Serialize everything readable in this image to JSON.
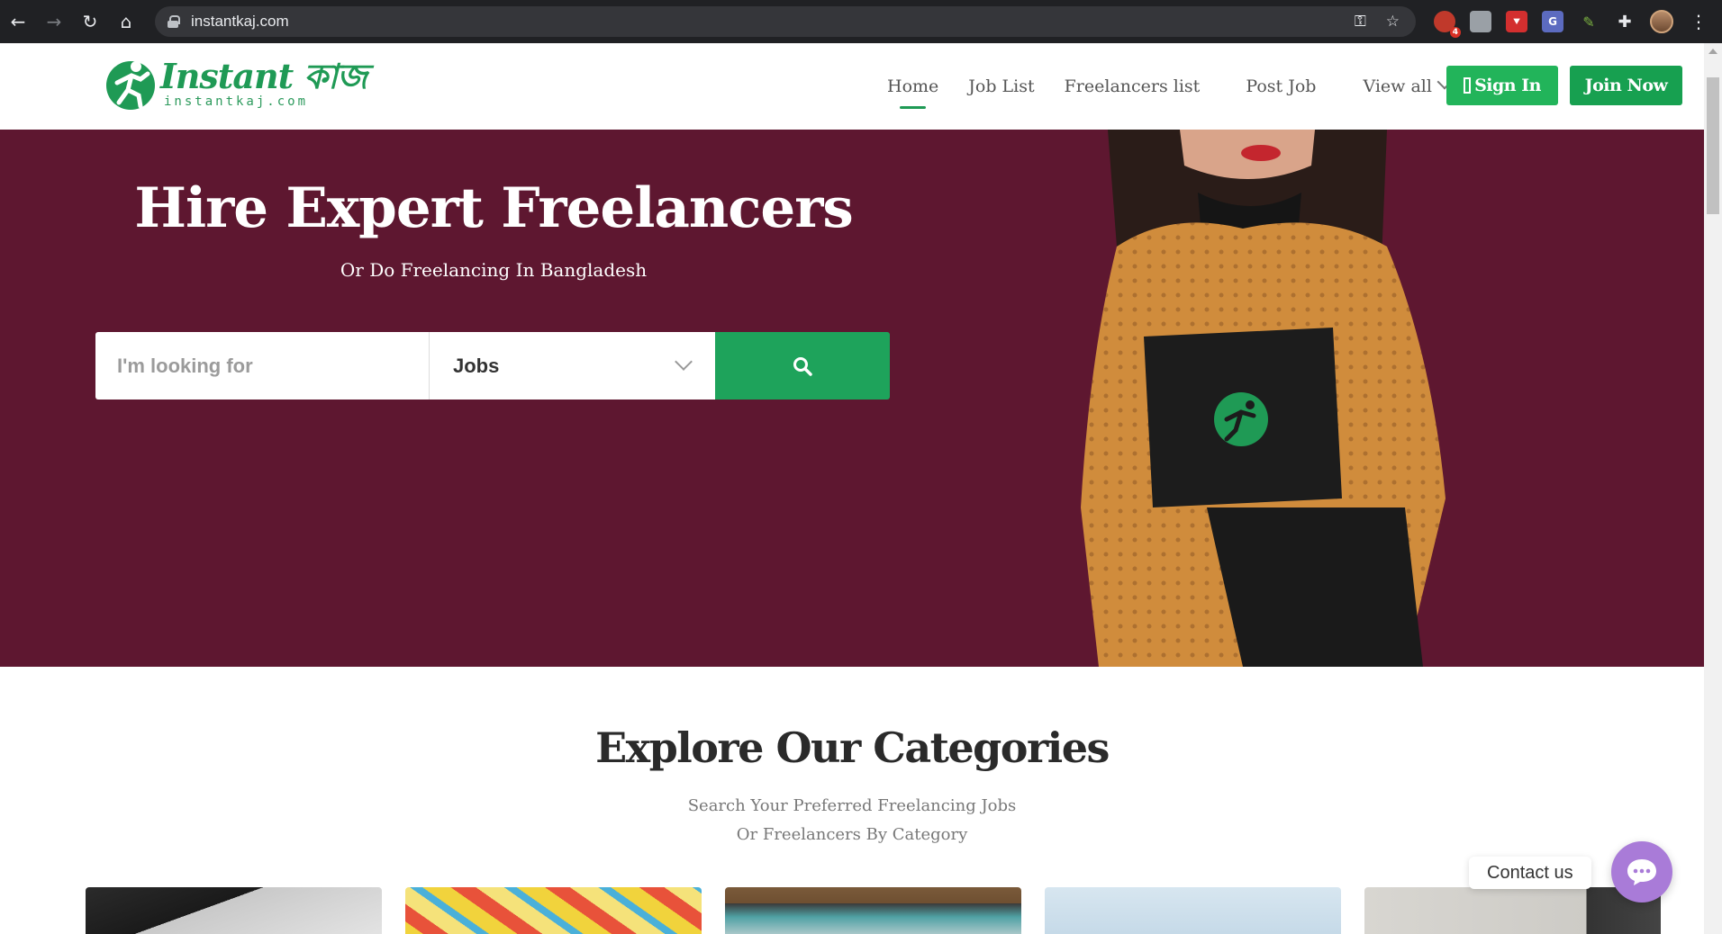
{
  "browser": {
    "url": "instantkaj.com",
    "back_icon": "arrow-left-icon",
    "forward_icon": "arrow-right-icon",
    "reload_icon": "reload-icon",
    "home_icon": "home-icon",
    "extension_badge": "4"
  },
  "header": {
    "logo_title": "Instant কাজ",
    "logo_url": "instantkaj.com",
    "nav": [
      {
        "label": "Home"
      },
      {
        "label": "Job List"
      },
      {
        "label": "Freelancers list"
      },
      {
        "label": "Post Job"
      },
      {
        "label": "View all"
      }
    ],
    "sign_in_label": "Sign In",
    "join_label": "Join Now"
  },
  "hero": {
    "title": "Hire Expert Freelancers",
    "subtitle": "Or Do Freelancing In Bangladesh",
    "search_placeholder": "I'm looking for",
    "select_value": "Jobs",
    "background_color": "#5e1730"
  },
  "categories": {
    "title": "Explore Our Categories",
    "subtitle_line1": "Search Your Preferred Freelancing Jobs",
    "subtitle_line2": "Or Freelancers By Category"
  },
  "contact": {
    "label": "Contact us"
  },
  "colors": {
    "brand_green": "#1f9a55",
    "button_green": "#22b45a",
    "contact_purple": "#a97bd8"
  }
}
